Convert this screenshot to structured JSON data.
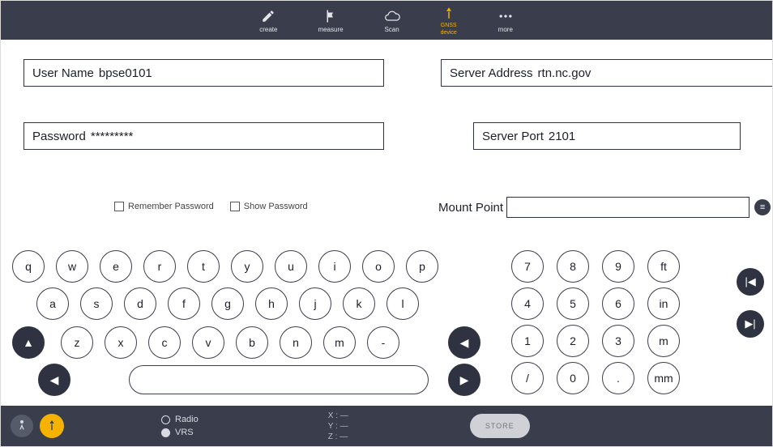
{
  "topnav": {
    "items": [
      {
        "label": "create"
      },
      {
        "label": "measure"
      },
      {
        "label": "Scan"
      },
      {
        "label": "GNSS",
        "sub": "device",
        "active": true
      },
      {
        "label": "more"
      }
    ]
  },
  "form": {
    "user": {
      "label": "User Name",
      "value": "bpse0101"
    },
    "server": {
      "label": "Server Address",
      "value": "rtn.nc.gov"
    },
    "pass": {
      "label": "Password",
      "value": "*********"
    },
    "port": {
      "label": "Server Port",
      "value": "2101"
    },
    "remember": "Remember Password",
    "show": "Show Password",
    "mount": {
      "label": "Mount Point",
      "value": ""
    }
  },
  "keyboard": {
    "row1": [
      "q",
      "w",
      "e",
      "r",
      "t",
      "y",
      "u",
      "i",
      "o",
      "p"
    ],
    "row2": [
      "a",
      "s",
      "d",
      "f",
      "g",
      "h",
      "j",
      "k",
      "l"
    ],
    "row3": [
      "z",
      "x",
      "c",
      "v",
      "b",
      "n",
      "m",
      "-"
    ],
    "pad1": [
      "7",
      "8",
      "9",
      "ft"
    ],
    "pad2": [
      "4",
      "5",
      "6",
      "in"
    ],
    "pad3": [
      "1",
      "2",
      "3",
      "m"
    ],
    "pad4": [
      "/",
      "0",
      ".",
      "mm"
    ]
  },
  "bottom": {
    "radio": "Radio",
    "vrs": "VRS",
    "x": "X : —",
    "y": "Y : —",
    "z": "Z : —",
    "store": "STORE"
  }
}
